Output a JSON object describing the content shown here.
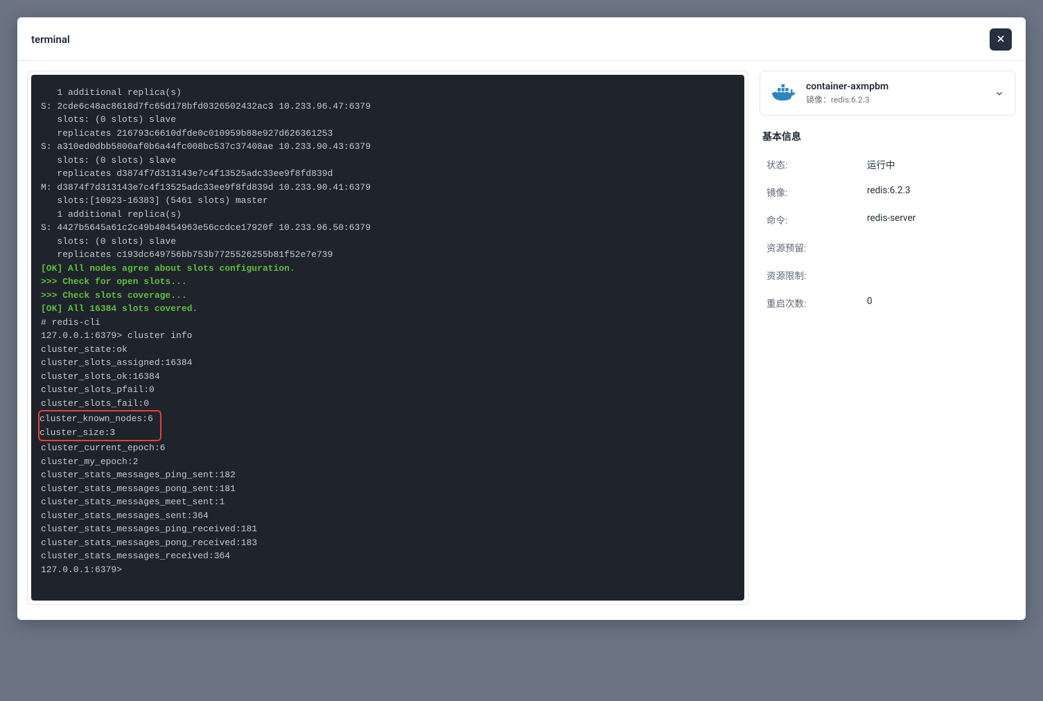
{
  "modal": {
    "title": "terminal"
  },
  "terminal": {
    "lines": [
      {
        "indent": 1,
        "text": "1 additional replica(s)"
      },
      {
        "indent": 0,
        "text": "S: 2cde6c48ac8618d7fc65d178bfd0326502432ac3 10.233.96.47:6379"
      },
      {
        "indent": 1,
        "text": "slots: (0 slots) slave"
      },
      {
        "indent": 1,
        "text": "replicates 216793c6610dfde0c010959b88e927d626361253"
      },
      {
        "indent": 0,
        "text": "S: a310ed0dbb5800af0b6a44fc008bc537c37408ae 10.233.90.43:6379"
      },
      {
        "indent": 1,
        "text": "slots: (0 slots) slave"
      },
      {
        "indent": 1,
        "text": "replicates d3874f7d313143e7c4f13525adc33ee9f8fd839d"
      },
      {
        "indent": 0,
        "text": "M: d3874f7d313143e7c4f13525adc33ee9f8fd839d 10.233.90.41:6379"
      },
      {
        "indent": 1,
        "text": "slots:[10923-16383] (5461 slots) master"
      },
      {
        "indent": 1,
        "text": "1 additional replica(s)"
      },
      {
        "indent": 0,
        "text": "S: 4427b5645a61c2c49b40454963e56ccdce17920f 10.233.96.50:6379"
      },
      {
        "indent": 1,
        "text": "slots: (0 slots) slave"
      },
      {
        "indent": 1,
        "text": "replicates c193dc649756bb753b7725526255b81f52e7e739"
      },
      {
        "indent": 0,
        "style": "green",
        "text": "[OK] All nodes agree about slots configuration."
      },
      {
        "indent": 0,
        "style": "accent",
        "text": ">>> Check for open slots..."
      },
      {
        "indent": 0,
        "style": "accent",
        "text": ">>> Check slots coverage..."
      },
      {
        "indent": 0,
        "style": "green",
        "text": "[OK] All 16384 slots covered."
      },
      {
        "indent": 0,
        "text": "# redis-cli"
      },
      {
        "indent": 0,
        "text": "127.0.0.1:6379> cluster info"
      },
      {
        "indent": 0,
        "text": "cluster_state:ok"
      },
      {
        "indent": 0,
        "text": "cluster_slots_assigned:16384"
      },
      {
        "indent": 0,
        "text": "cluster_slots_ok:16384"
      },
      {
        "indent": 0,
        "text": "cluster_slots_pfail:0"
      },
      {
        "indent": 0,
        "text": "cluster_slots_fail:0"
      },
      {
        "indent": 0,
        "highlight": true,
        "text": "cluster_known_nodes:6"
      },
      {
        "indent": 0,
        "highlight": true,
        "text": "cluster_size:3"
      },
      {
        "indent": 0,
        "text": "cluster_current_epoch:6"
      },
      {
        "indent": 0,
        "text": "cluster_my_epoch:2"
      },
      {
        "indent": 0,
        "text": "cluster_stats_messages_ping_sent:182"
      },
      {
        "indent": 0,
        "text": "cluster_stats_messages_pong_sent:181"
      },
      {
        "indent": 0,
        "text": "cluster_stats_messages_meet_sent:1"
      },
      {
        "indent": 0,
        "text": "cluster_stats_messages_sent:364"
      },
      {
        "indent": 0,
        "text": "cluster_stats_messages_ping_received:181"
      },
      {
        "indent": 0,
        "text": "cluster_stats_messages_pong_received:183"
      },
      {
        "indent": 0,
        "text": "cluster_stats_messages_received:364"
      },
      {
        "indent": 0,
        "text": "127.0.0.1:6379>"
      }
    ]
  },
  "side": {
    "container": {
      "name": "container-axmpbm",
      "image_label": "镜像：",
      "image_value": "redis:6.2.3"
    },
    "section_title": "基本信息",
    "info": [
      {
        "key": "状态:",
        "val": "运行中"
      },
      {
        "key": "镜像:",
        "val": "redis:6.2.3"
      },
      {
        "key": "命令:",
        "val": "redis-server"
      },
      {
        "key": "资源预留:",
        "val": ""
      },
      {
        "key": "资源限制:",
        "val": ""
      },
      {
        "key": "重启次数:",
        "val": "0"
      }
    ]
  }
}
